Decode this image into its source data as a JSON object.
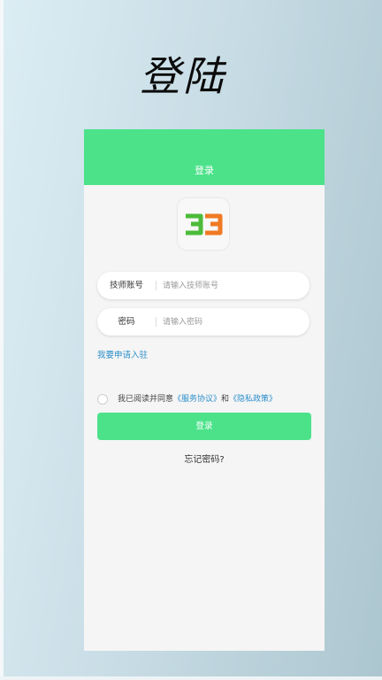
{
  "hero": {
    "title": "登陆"
  },
  "app": {
    "header_title": "登录",
    "logo_text": "33",
    "form": {
      "account": {
        "label": "技师账号",
        "placeholder": "请输入技师账号",
        "value": ""
      },
      "password": {
        "label": "密码",
        "placeholder": "请输入密码",
        "value": ""
      }
    },
    "apply_link": "我要申请入驻",
    "agreement": {
      "prefix": "我已阅读并同意",
      "service": "《服务协议》",
      "and": "和",
      "privacy": "《隐私政策》",
      "checked": false
    },
    "login_button": "登录",
    "forgot_password": "忘记密码?"
  },
  "colors": {
    "brand_green": "#4ce28a",
    "link_blue": "#2c8fcb",
    "logo_green": "#4cbb3a",
    "logo_orange": "#f07a24"
  },
  "icons": [
    "radio-unchecked-icon"
  ]
}
